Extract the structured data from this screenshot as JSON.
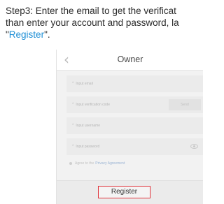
{
  "instruction": {
    "line1": "Step3: Enter the email to get the verificat",
    "line2": "than enter your account and password, la",
    "quote_open": "\"",
    "register_word": "Register",
    "quote_close": "\"."
  },
  "app": {
    "title": "Owner",
    "fields": {
      "email_placeholder": "Input email",
      "code_placeholder": "Input verification code",
      "send_label": "Send",
      "username_placeholder": "Input username",
      "password_placeholder": "Input password"
    },
    "agreement": {
      "prefix": "Agree to the",
      "link": "Privacy Agreement"
    },
    "register_label": "Register"
  },
  "colors": {
    "highlight": "#1e8fd6",
    "register_border": "#e0333a"
  }
}
